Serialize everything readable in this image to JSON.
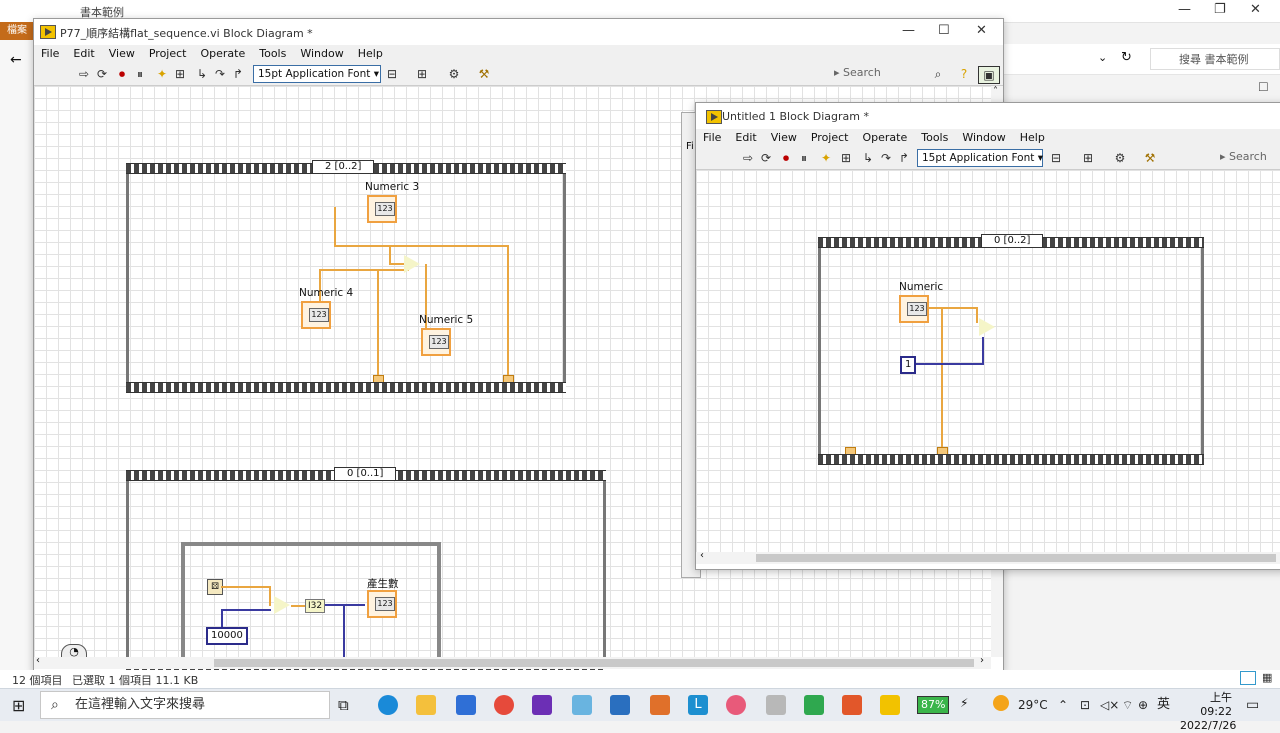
{
  "explorer": {
    "title": "書本範例",
    "ribbon_tab": "檔案",
    "search_placeholder": "搜尋 書本範例",
    "status_items": "12 個項目",
    "status_selected": "已選取 1 個項目  11.1 KB"
  },
  "window1": {
    "title": "P77_順序結構flat_sequence.vi Block Diagram *",
    "menu": [
      "File",
      "Edit",
      "View",
      "Project",
      "Operate",
      "Tools",
      "Window",
      "Help"
    ],
    "font": "15pt Application Font",
    "search": "Search",
    "frame1_selector": "2 [0..2]",
    "frame2_selector": "0 [0..1]",
    "numeric3": "Numeric 3",
    "numeric4": "Numeric 4",
    "numeric5": "Numeric 5",
    "produce": "產生數",
    "const10000": "10000",
    "i32": "I32",
    "num_glyph": "123"
  },
  "window2": {
    "title": "Untitled 1 Block Diagram *",
    "menu": [
      "File",
      "Edit",
      "View",
      "Project",
      "Operate",
      "Tools",
      "Window",
      "Help"
    ],
    "font": "15pt Application Font",
    "search": "Search",
    "selector": "0 [0..2]",
    "numeric": "Numeric",
    "const1": "1",
    "num_glyph": "123",
    "behind_menu": "Fi"
  },
  "taskbar": {
    "search_placeholder": "在這裡輸入文字來搜尋",
    "battery": "87%",
    "temperature": "29°C",
    "ime": "英",
    "time": "上午 09:22",
    "date": "2022/7/26"
  }
}
